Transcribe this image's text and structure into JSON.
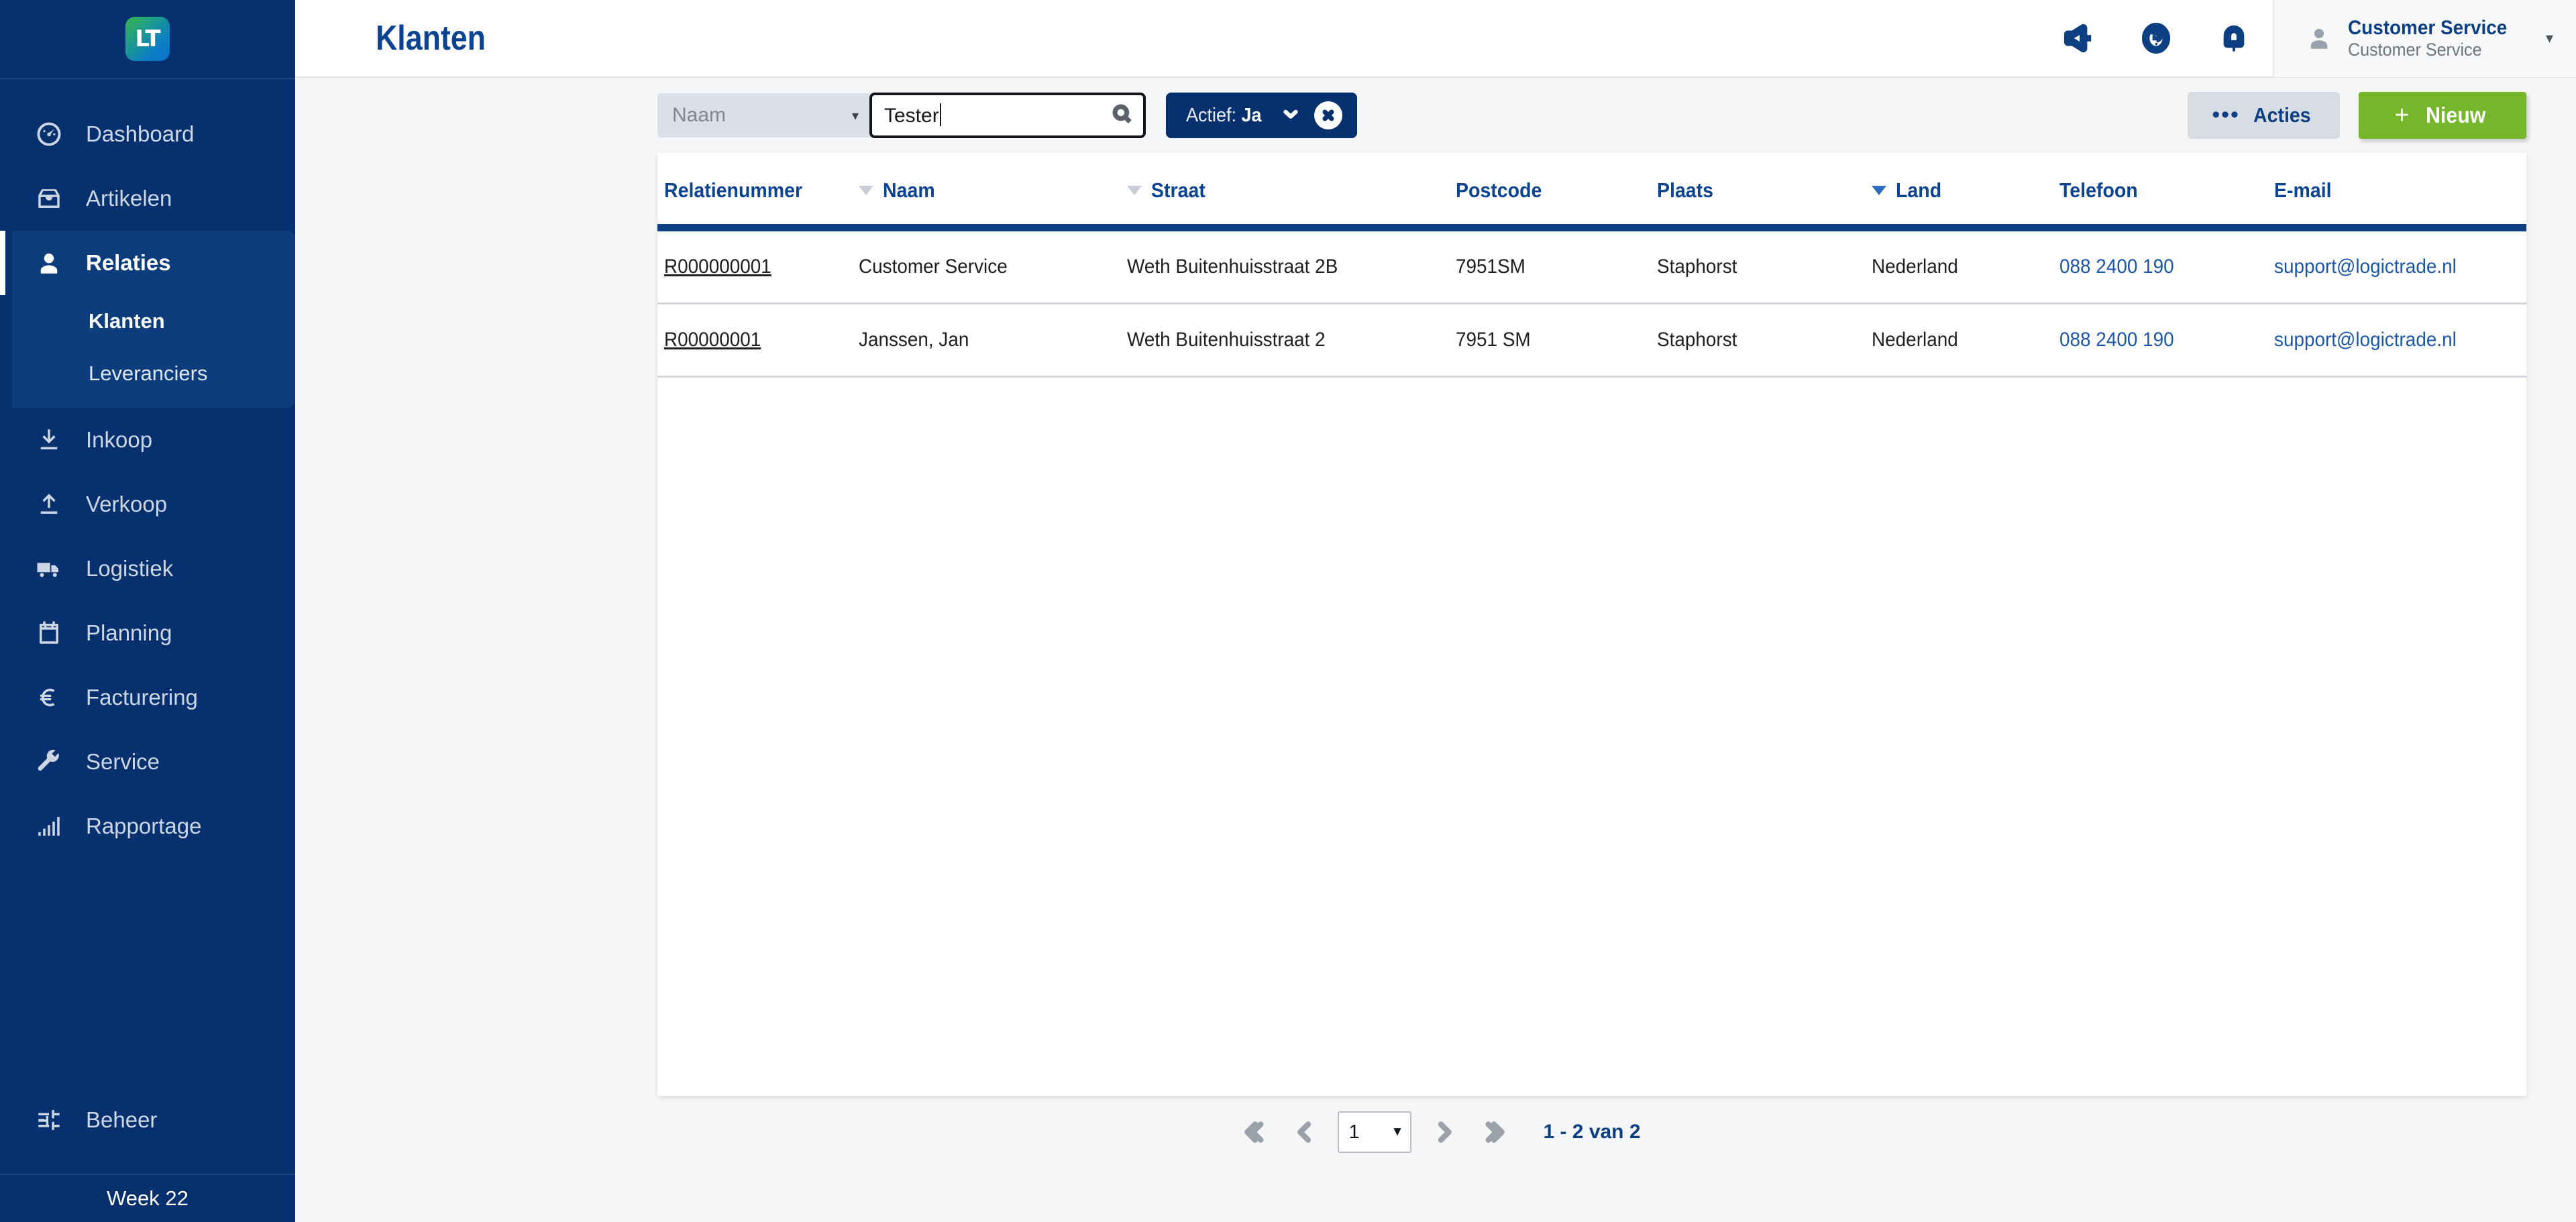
{
  "sidebar": {
    "logo_text": "LT",
    "items": [
      {
        "label": "Dashboard",
        "icon": "gauge-icon",
        "active": false
      },
      {
        "label": "Artikelen",
        "icon": "box-icon",
        "active": false
      },
      {
        "label": "Relaties",
        "icon": "user-icon",
        "active": true
      },
      {
        "label": "Inkoop",
        "icon": "download-icon",
        "active": false
      },
      {
        "label": "Verkoop",
        "icon": "upload-icon",
        "active": false
      },
      {
        "label": "Logistiek",
        "icon": "truck-icon",
        "active": false
      },
      {
        "label": "Planning",
        "icon": "calendar-icon",
        "active": false
      },
      {
        "label": "Facturering",
        "icon": "euro-icon",
        "active": false
      },
      {
        "label": "Service",
        "icon": "wrench-icon",
        "active": false
      },
      {
        "label": "Rapportage",
        "icon": "bar-chart-icon",
        "active": false
      }
    ],
    "submenu": [
      {
        "label": "Klanten",
        "active": true
      },
      {
        "label": "Leveranciers",
        "active": false
      }
    ],
    "admin_label": "Beheer",
    "week_label": "Week 22"
  },
  "header": {
    "title": "Klanten",
    "icons": [
      "megaphone-icon",
      "help-circle-icon",
      "bell-icon"
    ],
    "user_name": "Customer Service",
    "user_role": "Customer Service",
    "caret": "▾"
  },
  "toolbar": {
    "filter_field_label": "Naam",
    "filter_field_caret": "▾",
    "search_value": "Tester",
    "search_placeholder": "",
    "chip_prefix": "Actief:",
    "chip_value": "Ja",
    "acties_label": "Acties",
    "acties_dots": "•••",
    "nieuw_label": "Nieuw",
    "nieuw_plus": "+"
  },
  "table": {
    "columns": [
      {
        "label": "Relatienummer",
        "sort": "none",
        "key": "relatienummer"
      },
      {
        "label": "Naam",
        "sort": "idle",
        "key": "naam"
      },
      {
        "label": "Straat",
        "sort": "idle",
        "key": "straat"
      },
      {
        "label": "Postcode",
        "sort": "none",
        "key": "postcode"
      },
      {
        "label": "Plaats",
        "sort": "none",
        "key": "plaats"
      },
      {
        "label": "Land",
        "sort": "active",
        "key": "land"
      },
      {
        "label": "Telefoon",
        "sort": "none",
        "key": "telefoon"
      },
      {
        "label": "E-mail",
        "sort": "none",
        "key": "email"
      }
    ],
    "rows": [
      {
        "relatienummer": "R000000001",
        "naam": "Customer Service",
        "straat": "Weth Buitenhuisstraat 2B",
        "postcode": "7951SM",
        "plaats": "Staphorst",
        "land": "Nederland",
        "telefoon": "088 2400 190",
        "email": "support@logictrade.nl"
      },
      {
        "relatienummer": "R00000001",
        "naam": "Janssen, Jan",
        "straat": "Weth Buitenhuisstraat 2",
        "postcode": "7951 SM",
        "plaats": "Staphorst",
        "land": "Nederland",
        "telefoon": "088 2400 190",
        "email": "support@logictrade.nl"
      }
    ]
  },
  "pagination": {
    "current_page": "1",
    "caret": "▼",
    "range_text": "1 - 2 van 2"
  },
  "colors": {
    "sidebar_bg": "#06306e",
    "sidebar_active": "#0d3d7d",
    "accent_blue": "#0d4491",
    "green_button": "#74b72b",
    "link_blue": "#1c56a8"
  }
}
